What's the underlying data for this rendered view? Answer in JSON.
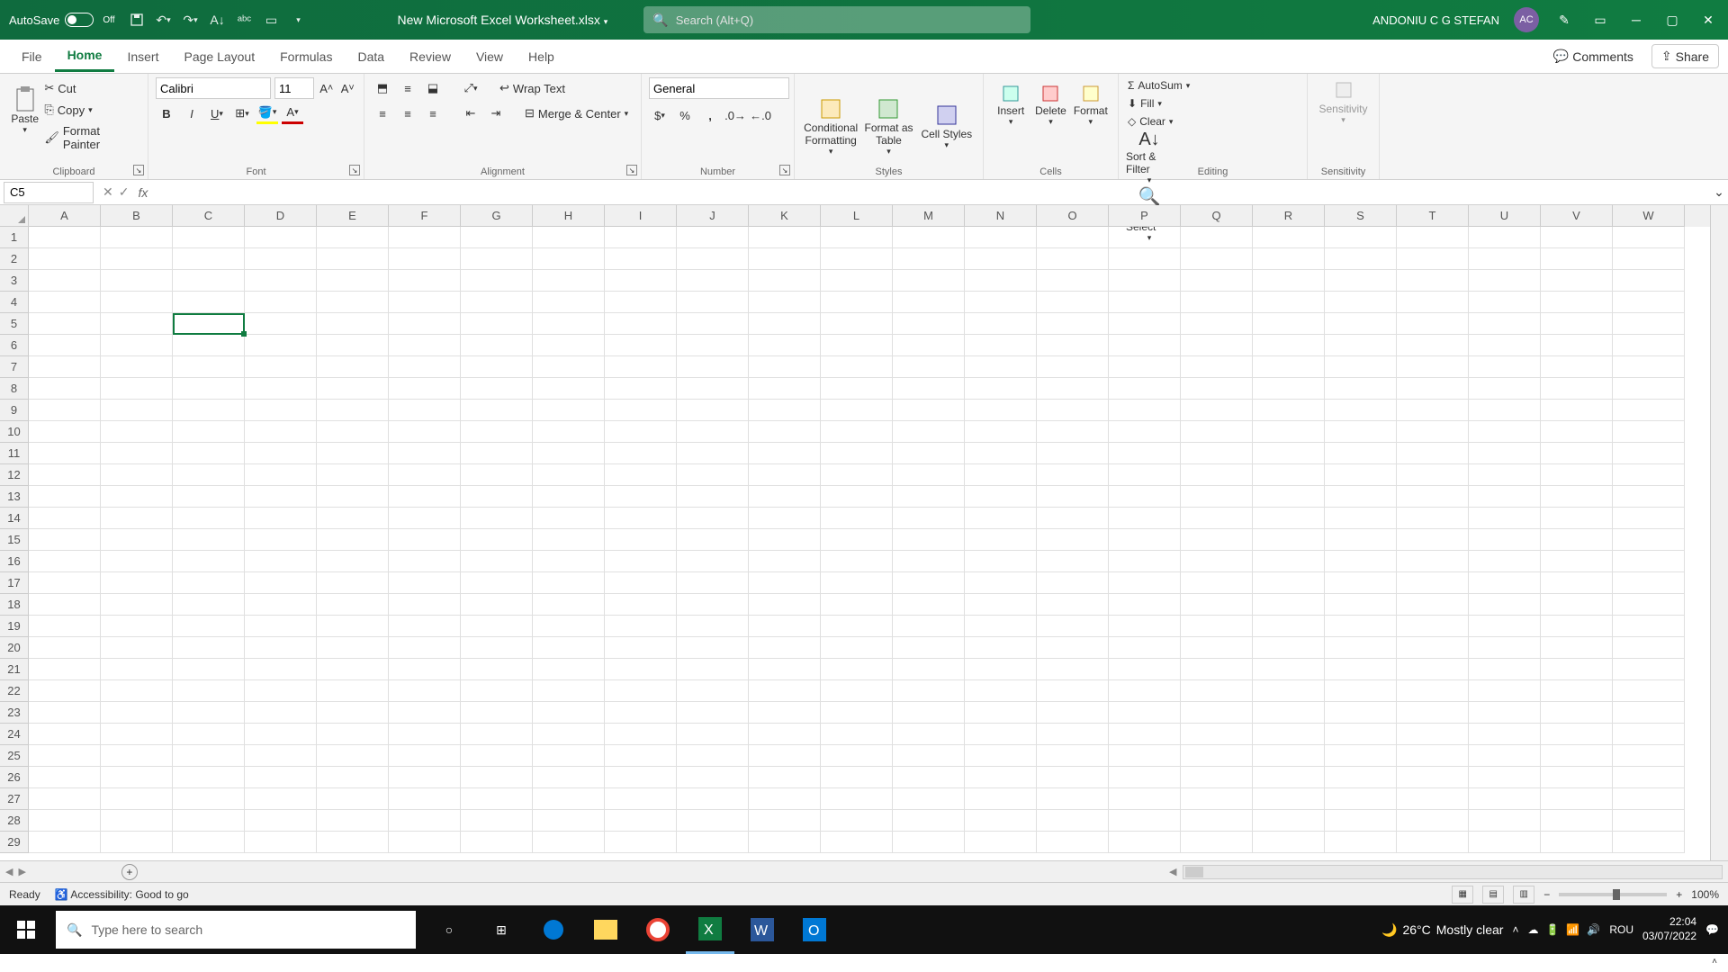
{
  "title_bar": {
    "autosave": "AutoSave",
    "autosave_state": "Off",
    "doc_title": "New Microsoft Excel Worksheet.xlsx",
    "search_placeholder": "Search (Alt+Q)",
    "user_name": "ANDONIU C G STEFAN",
    "user_initials": "AC"
  },
  "tabs": {
    "items": [
      "File",
      "Home",
      "Insert",
      "Page Layout",
      "Formulas",
      "Data",
      "Review",
      "View",
      "Help"
    ],
    "active": "Home",
    "comments": "Comments",
    "share": "Share"
  },
  "ribbon": {
    "clipboard": {
      "label": "Clipboard",
      "paste": "Paste",
      "cut": "Cut",
      "copy": "Copy",
      "format_painter": "Format Painter"
    },
    "font": {
      "label": "Font",
      "name": "Calibri",
      "size": "11"
    },
    "alignment": {
      "label": "Alignment",
      "wrap": "Wrap Text",
      "merge": "Merge & Center"
    },
    "number": {
      "label": "Number",
      "format": "General"
    },
    "styles": {
      "label": "Styles",
      "conditional": "Conditional Formatting",
      "format_as": "Format as Table",
      "cell": "Cell Styles"
    },
    "cells": {
      "label": "Cells",
      "insert": "Insert",
      "delete": "Delete",
      "format": "Format"
    },
    "editing": {
      "label": "Editing",
      "autosum": "AutoSum",
      "fill": "Fill",
      "clear": "Clear",
      "sort": "Sort & Filter",
      "find": "Find & Select"
    },
    "sensitivity": {
      "label": "Sensitivity",
      "btn": "Sensitivity"
    }
  },
  "formula_bar": {
    "name_box": "C5"
  },
  "grid": {
    "columns": [
      "A",
      "B",
      "C",
      "D",
      "E",
      "F",
      "G",
      "H",
      "I",
      "J",
      "K",
      "L",
      "M",
      "N",
      "O",
      "P",
      "Q",
      "R",
      "S",
      "T",
      "U",
      "V",
      "W"
    ],
    "rows": [
      "1",
      "2",
      "3",
      "4",
      "5",
      "6",
      "7",
      "8",
      "9",
      "10",
      "11",
      "12",
      "13",
      "14",
      "15",
      "16",
      "17",
      "18",
      "19",
      "20",
      "21",
      "22",
      "23",
      "24",
      "25",
      "26",
      "27",
      "28",
      "29"
    ],
    "active_cell": "C5"
  },
  "status": {
    "ready": "Ready",
    "accessibility": "Accessibility: Good to go",
    "zoom": "100%"
  },
  "taskbar": {
    "search_placeholder": "Type here to search",
    "weather_temp": "26°C",
    "weather_desc": "Mostly clear",
    "lang": "ROU",
    "time": "22:04",
    "date": "03/07/2022"
  }
}
